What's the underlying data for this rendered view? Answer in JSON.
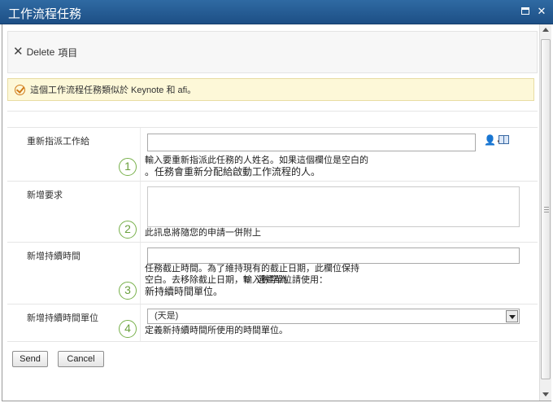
{
  "window": {
    "title": "工作流程任務",
    "maximize_glyph": "",
    "close_glyph": "✕"
  },
  "ribbon": {
    "delete_label": "Delete",
    "item_label": "項目"
  },
  "notice": {
    "text": "這個工作流程任務類似於 Keynote 和 afi。"
  },
  "form": {
    "reassign": {
      "label": "重新指派工作給",
      "value": "",
      "step": "1",
      "desc_line1": "輸入要重新指派此任務的人姓名。如果這個欄位是空白的",
      "desc_line2": "。任務會重新分配給啟動工作流程的人。"
    },
    "new_request": {
      "label": "新增要求",
      "value": "",
      "step": "2",
      "desc": "此訊息將隨您的申請一併附上"
    },
    "duration": {
      "label": "新增持續時間",
      "value": "",
      "step": "3",
      "desc_line1": "任務截止時間。為了維持現有的截止日期，此欄位保持",
      "desc_line2a": "空白。去移除截止日期，輸入數字為",
      "desc_line2b": "'0'",
      "desc_line2c": "選擇單位請使用：",
      "desc_line3": "新持續時間單位。"
    },
    "duration_unit": {
      "label": "新增持續時間單位",
      "selected": "(天是)",
      "step": "4",
      "desc": "定義新持續時間所使用的時間單位。"
    }
  },
  "buttons": {
    "send": "Send",
    "cancel": "Cancel"
  }
}
